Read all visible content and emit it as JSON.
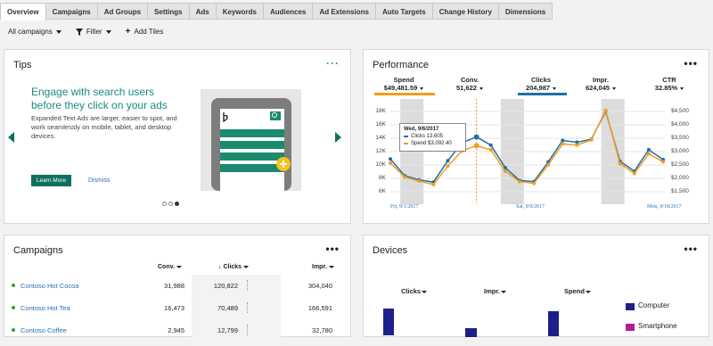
{
  "tabs": [
    "Overview",
    "Campaigns",
    "Ad Groups",
    "Settings",
    "Ads",
    "Keywords",
    "Audiences",
    "Ad Extensions",
    "Auto Targets",
    "Change History",
    "Dimensions"
  ],
  "toolbar": {
    "campaigns": "All campaigns",
    "filter": "Filter",
    "add_tiles": "Add Tiles"
  },
  "tips": {
    "title": "Tips",
    "more": "···",
    "headline": "Engage with search users before they click on your ads",
    "body": "Expanded Text Ads are larger, easier to spot, and work seamlessly on mobile, tablet, and desktop devices.",
    "learn_more": "Learn More",
    "dismiss": "Dismiss",
    "page_count": 3,
    "active_page": 3
  },
  "performance": {
    "title": "Performance",
    "more": "•••",
    "metrics": [
      {
        "name": "Spend",
        "value": "$49,481.59",
        "color": "#f39c1f"
      },
      {
        "name": "Conv.",
        "value": "51,622",
        "color": ""
      },
      {
        "name": "Clicks",
        "value": "204,987",
        "color": "#1e6fa8"
      },
      {
        "name": "Impr.",
        "value": "624,045",
        "color": ""
      },
      {
        "name": "CTR",
        "value": "32.85%",
        "color": ""
      }
    ],
    "tooltip": {
      "date": "Wed, 9/6/2017",
      "clicks": "Clicks 13,605",
      "spend": "Spend $3,092.40"
    }
  },
  "chart_data": {
    "type": "line",
    "x": [
      "8/31",
      "9/1",
      "9/2",
      "9/3",
      "9/4",
      "9/5",
      "9/6",
      "9/7",
      "9/8",
      "9/9",
      "9/10",
      "9/11",
      "9/12",
      "9/13",
      "9/14",
      "9/15",
      "9/16",
      "9/17",
      "9/18",
      "9/19"
    ],
    "x_tick_labels": [
      "Fri, 9/1/2017",
      "Sat, 9/9/2017",
      "Mon, 9/18/2017"
    ],
    "y_left_ticks": [
      "18K",
      "16K",
      "14K",
      "12K",
      "10K",
      "8K",
      "6K"
    ],
    "y_right_ticks": [
      "$4,500",
      "$4,000",
      "$3,500",
      "$3,000",
      "$2,500",
      "$2,000",
      "$1,500"
    ],
    "ylim_left": [
      5000,
      19000
    ],
    "series": [
      {
        "name": "Clicks",
        "color": "#1e6fa8",
        "values": [
          10800,
          7900,
          7200,
          6800,
          10500,
          13600,
          14600,
          13200,
          9300,
          7100,
          6900,
          10300,
          14000,
          13700,
          14200,
          19000,
          10400,
          8700,
          12400,
          10700
        ]
      },
      {
        "name": "Spend",
        "color": "#f39c1f",
        "values": [
          10100,
          7700,
          7000,
          6400,
          9600,
          12200,
          13100,
          12400,
          8700,
          6900,
          6600,
          9800,
          13400,
          13200,
          14100,
          19200,
          10000,
          8300,
          11700,
          10300
        ]
      }
    ],
    "highlighted_index": 6
  },
  "campaigns": {
    "title": "Campaigns",
    "more": "•••",
    "columns": {
      "conv": "Conv.",
      "clicks": "Clicks",
      "impr": "Impr."
    },
    "rows": [
      {
        "name": "Contoso Hot Cocoa",
        "conv": "31,988",
        "clicks": "120,822",
        "impr": "304,040"
      },
      {
        "name": "Contoso Hot Tea",
        "conv": "16,473",
        "clicks": "70,489",
        "impr": "166,591"
      },
      {
        "name": "Contoso Coffee",
        "conv": "2,945",
        "clicks": "12,799",
        "impr": "32,780"
      }
    ]
  },
  "devices": {
    "title": "Devices",
    "more": "•••",
    "metrics": [
      "Clicks",
      "Impr.",
      "Spend"
    ],
    "legend": [
      {
        "name": "Computer",
        "color": "#1c1f8c"
      },
      {
        "name": "Smartphone",
        "color": "#b21f8e"
      }
    ]
  }
}
